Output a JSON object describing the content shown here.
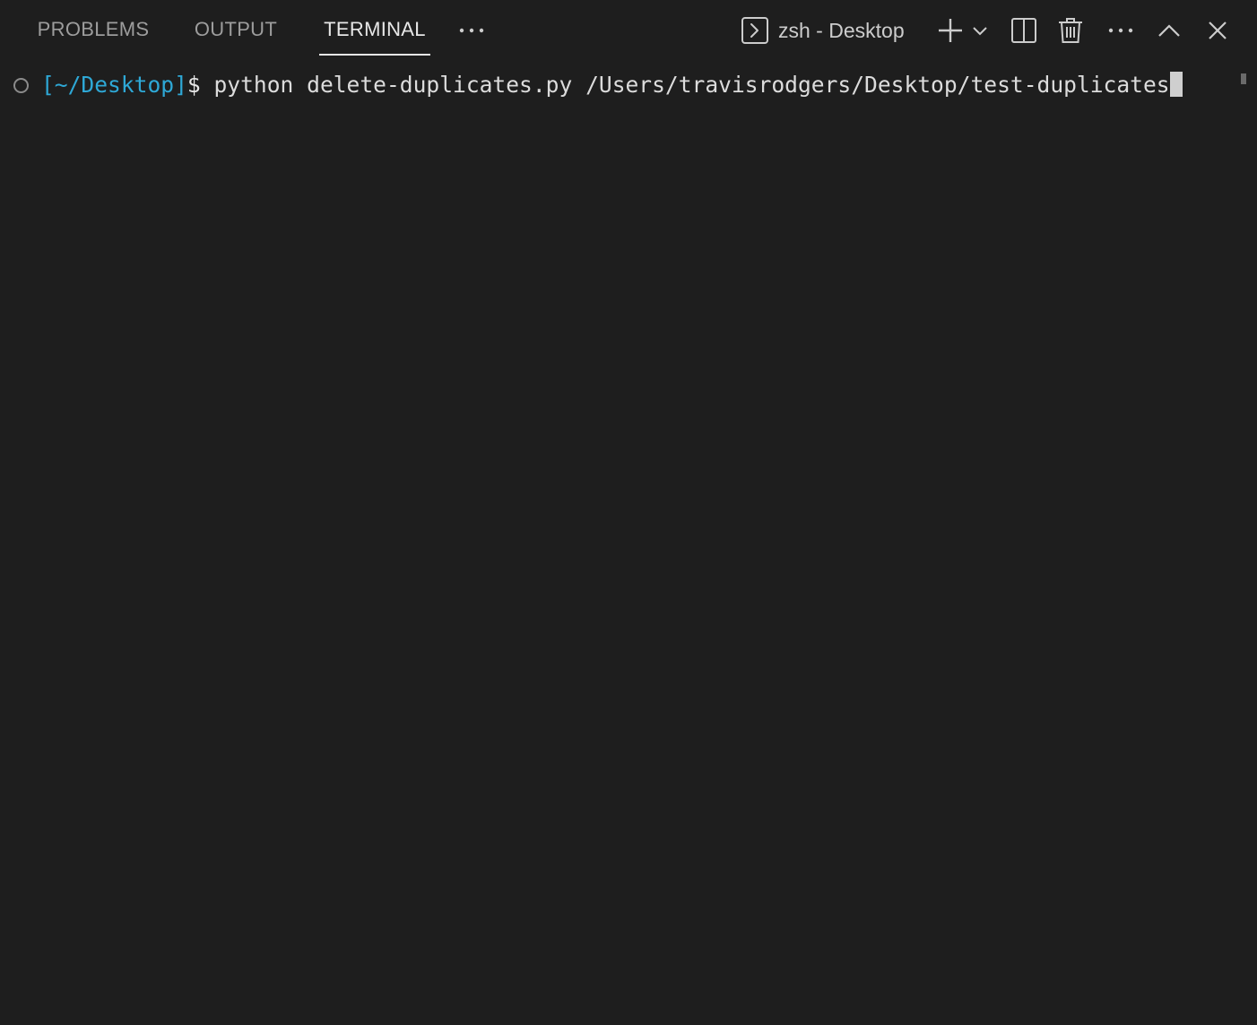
{
  "tabs": [
    {
      "label": "PROBLEMS",
      "active": false
    },
    {
      "label": "OUTPUT",
      "active": false
    },
    {
      "label": "TERMINAL",
      "active": true
    }
  ],
  "header": {
    "more_tabs_icon": "ellipsis-icon",
    "terminal_instance_icon": "terminal-icon",
    "terminal_instance_label": "zsh - Desktop",
    "actions": [
      "plus-icon",
      "chevron-down-icon",
      "split-icon",
      "trash-icon",
      "ellipsis-icon",
      "chevron-up-icon",
      "close-icon"
    ]
  },
  "terminal": {
    "decoration": "circle-icon",
    "prompt_path": "[~/Desktop]",
    "prompt_symbol": "$",
    "command": " python delete-duplicates.py /Users/travisrodgers/Desktop/test-duplicates"
  },
  "colors": {
    "background": "#1e1e1e",
    "prompt_path": "#2ea8d6",
    "active_tab": "#e7e7e7",
    "inactive_tab": "#9d9d9d"
  }
}
